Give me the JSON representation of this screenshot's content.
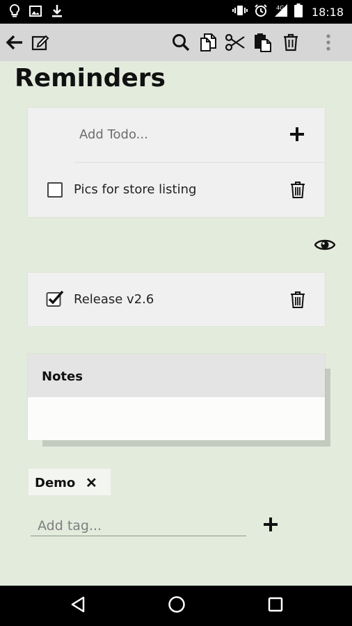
{
  "status_bar": {
    "time": "18:18",
    "left_icons": [
      "bulb-icon",
      "image-icon",
      "download-icon"
    ],
    "right_icons": [
      "vibrate-icon",
      "alarm-icon",
      "signal-4g-icon",
      "battery-icon"
    ]
  },
  "toolbar": {
    "actions": [
      "back-icon",
      "edit-icon",
      "search-icon",
      "copy-icon",
      "cut-icon",
      "paste-icon",
      "delete-icon",
      "overflow-menu-icon"
    ]
  },
  "page": {
    "title": "Reminders"
  },
  "todo_card": {
    "add_placeholder": "Add Todo...",
    "items": [
      {
        "label": "Pics for store listing",
        "checked": false
      }
    ]
  },
  "completed_card": {
    "items": [
      {
        "label": "Release v2.6",
        "checked": true
      }
    ]
  },
  "notes": {
    "title": "Notes",
    "content": ""
  },
  "tags": {
    "items": [
      "Demo"
    ],
    "remove_glyph": "✕",
    "input_placeholder": "Add tag..."
  },
  "colors": {
    "background": "#e3ebdd",
    "toolbar": "#d6d6d6",
    "card": "#f0f0f0"
  }
}
